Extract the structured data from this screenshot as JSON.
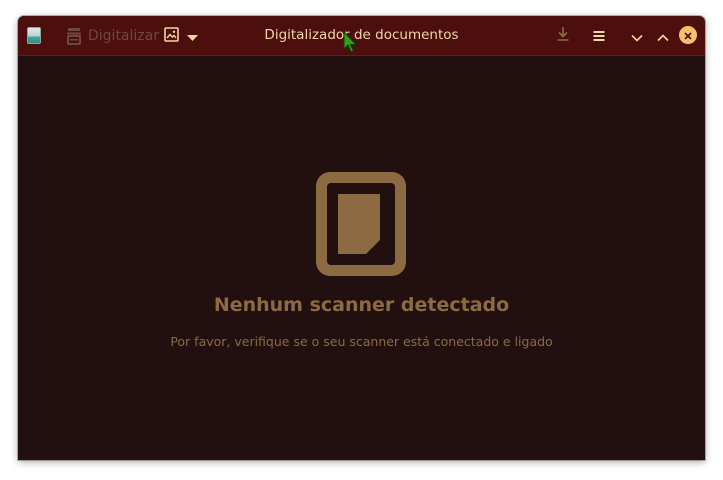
{
  "window": {
    "title": "Digitalizador de documentos"
  },
  "toolbar": {
    "scan_label": "Digitalizar",
    "scan_icon": "scanner-icon",
    "image_mode_icon": "image-icon",
    "image_mode_dropdown_icon": "chevron-down-icon",
    "save_icon": "download-icon",
    "menu_icon": "hamburger-menu-icon"
  },
  "window_controls": {
    "minimize_icon": "chevron-down-icon",
    "maximize_icon": "chevron-up-icon",
    "close_icon": "close-icon"
  },
  "empty_state": {
    "icon": "scanner-document-icon",
    "title": "Nenhum scanner detectado",
    "subtitle": "Por favor, verifique se o seu scanner está conectado e ligado"
  },
  "colors": {
    "titlebar": "#4d0e0e",
    "background": "#221010",
    "title_text": "#f0d9a6",
    "accent": "#8c6b43",
    "close_button": "#f5c26b"
  }
}
